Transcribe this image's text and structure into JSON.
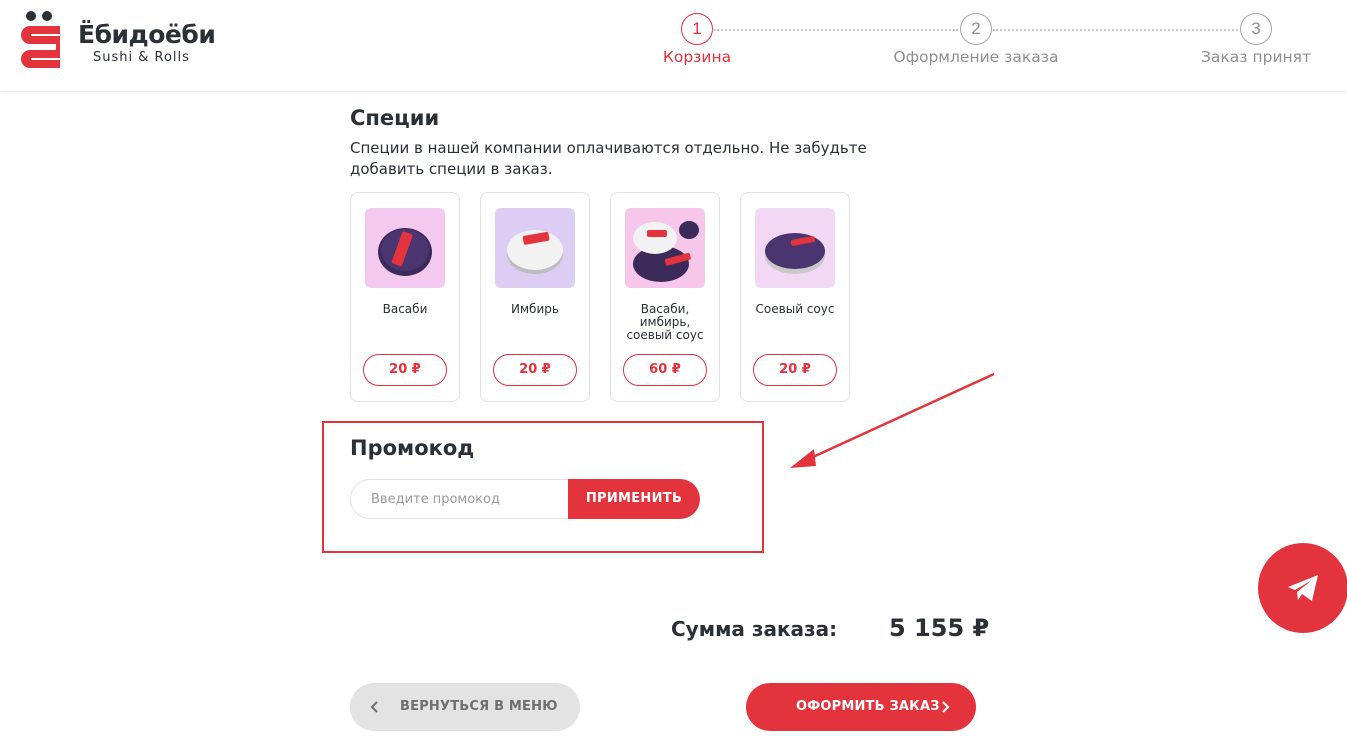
{
  "brand": {
    "name": "Ёбидоёби",
    "subtitle": "Sushi & Rolls",
    "accent_color": "#e3343e"
  },
  "steps": [
    {
      "number": "1",
      "label": "Корзина",
      "active": true
    },
    {
      "number": "2",
      "label": "Оформление заказа",
      "active": false
    },
    {
      "number": "3",
      "label": "Заказ принят",
      "active": false
    }
  ],
  "spices": {
    "title": "Специи",
    "description": "Специи в нашей компании оплачиваются отдельно. Не забудьте добавить специи в заказ.",
    "items": [
      {
        "name": "Васаби",
        "price": "20 ₽",
        "image_icon": "wasabi-package-icon"
      },
      {
        "name": "Имбирь",
        "price": "20 ₽",
        "image_icon": "ginger-package-icon"
      },
      {
        "name": "Васаби, имбирь, соевый соус",
        "price": "60 ₽",
        "image_icon": "combo-package-icon"
      },
      {
        "name": "Соевый соус",
        "price": "20 ₽",
        "image_icon": "soy-sauce-package-icon"
      }
    ]
  },
  "promo": {
    "title": "Промокод",
    "placeholder": "Введите промокод",
    "value": "",
    "apply_label": "ПРИМЕНИТЬ"
  },
  "summary": {
    "label": "Сумма заказа:",
    "value": "5 155 ₽"
  },
  "buttons": {
    "back_label": "ВЕРНУТЬСЯ В МЕНЮ",
    "order_label": "ОФОРМИТЬ ЗАКАЗ"
  },
  "floating": {
    "icon": "telegram-plane-icon"
  }
}
